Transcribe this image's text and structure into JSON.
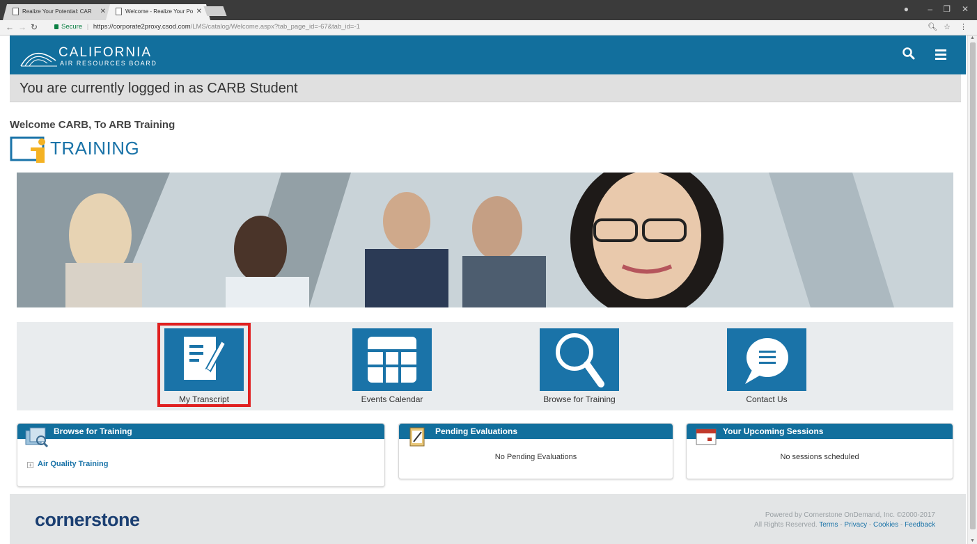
{
  "browser": {
    "tabs": [
      {
        "title": "Realize Your Potential: CAR"
      },
      {
        "title": "Welcome - Realize Your Po"
      }
    ],
    "url_secure": "Secure",
    "url_host": "https://corporate2proxy.csod.com",
    "url_path": "/LMS/catalog/Welcome.aspx?tab_page_id=-67&tab_id=-1"
  },
  "header": {
    "org_main": "CALIFORNIA",
    "org_sub": "AIR RESOURCES BOARD"
  },
  "logged_in_text": "You are currently logged in as CARB Student",
  "welcome_text": "Welcome CARB, To ARB Training",
  "training_logo_text": "TRAINING",
  "quick_links": [
    {
      "label": "My Transcript",
      "icon": "transcript-icon"
    },
    {
      "label": "Events Calendar",
      "icon": "calendar-icon"
    },
    {
      "label": "Browse for Training",
      "icon": "magnifier-icon"
    },
    {
      "label": "Contact Us",
      "icon": "speech-bubble-icon"
    }
  ],
  "widgets": {
    "browse": {
      "title": "Browse for Training",
      "item": "Air Quality Training"
    },
    "pending": {
      "title": "Pending Evaluations",
      "message": "No Pending Evaluations"
    },
    "upcoming": {
      "title": "Your Upcoming Sessions",
      "message": "No sessions scheduled"
    }
  },
  "footer": {
    "logo_text": "cornerstone",
    "powered_line": "Powered by Cornerstone OnDemand, Inc. ©2000-2017",
    "rights": "All Rights Reserved.",
    "links": [
      "Terms",
      "Privacy",
      "Cookies",
      "Feedback"
    ]
  },
  "colors": {
    "brand_blue": "#126f9d",
    "tile_blue": "#1a73a8",
    "highlight_red": "#e02020"
  }
}
